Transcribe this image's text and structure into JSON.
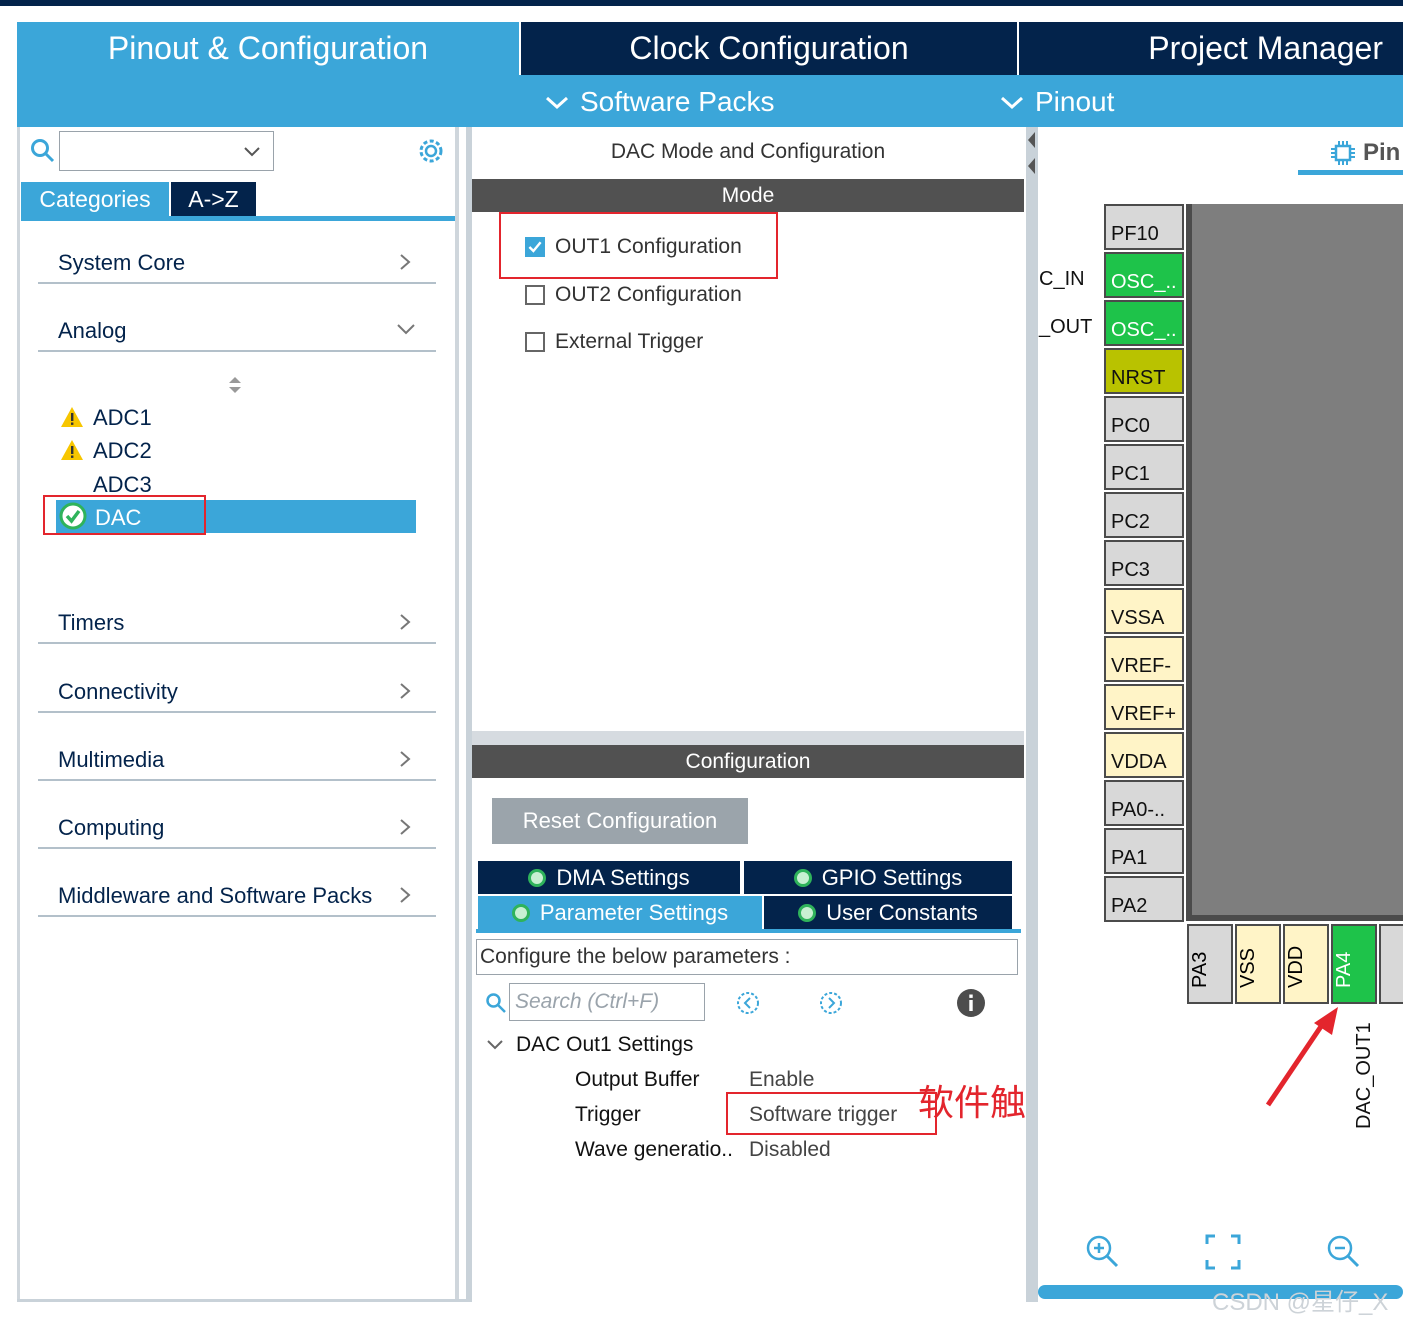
{
  "tabs": [
    {
      "label": "Pinout & Configuration"
    },
    {
      "label": "Clock Configuration"
    },
    {
      "label": "Project Manager"
    }
  ],
  "subbar": {
    "software_packs": "Software Packs",
    "pinout": "Pinout"
  },
  "left": {
    "search": {
      "value": ""
    },
    "tab_categories": "Categories",
    "tab_az": "A->Z",
    "categories": [
      {
        "label": "System Core"
      },
      {
        "label": "Analog"
      },
      {
        "label": "Timers"
      },
      {
        "label": "Connectivity"
      },
      {
        "label": "Multimedia"
      },
      {
        "label": "Computing"
      },
      {
        "label": "Middleware and Software Packs"
      }
    ],
    "analog_items": [
      {
        "label": "ADC1",
        "status": "warning"
      },
      {
        "label": "ADC2",
        "status": "warning"
      },
      {
        "label": "ADC3",
        "status": "none"
      },
      {
        "label": "DAC",
        "status": "ok"
      }
    ]
  },
  "middle": {
    "title": "DAC Mode and Configuration",
    "mode_header": "Mode",
    "mode_options": [
      {
        "label": "OUT1 Configuration",
        "checked": true
      },
      {
        "label": "OUT2 Configuration",
        "checked": false
      },
      {
        "label": "External Trigger",
        "checked": false
      }
    ],
    "config_header": "Configuration",
    "reset_button": "Reset Configuration",
    "settings_tabs": [
      {
        "label": "DMA Settings"
      },
      {
        "label": "GPIO Settings"
      },
      {
        "label": "Parameter Settings"
      },
      {
        "label": "User Constants"
      }
    ],
    "configure_text": "Configure the below parameters :",
    "param_search_placeholder": "Search (Ctrl+F)",
    "group_label": "DAC Out1 Settings",
    "params": [
      {
        "name": "Output Buffer",
        "value": "Enable"
      },
      {
        "name": "Trigger",
        "value": "Software trigger"
      },
      {
        "name": "Wave generatio..",
        "value": "Disabled"
      }
    ],
    "annotation": "软件触发"
  },
  "right": {
    "view_tab": "Pin",
    "side_labels": [
      "C_IN",
      "_OUT"
    ],
    "left_pins": [
      {
        "label": "PF10",
        "color": "grey"
      },
      {
        "label": "OSC_..",
        "color": "green"
      },
      {
        "label": "OSC_..",
        "color": "green"
      },
      {
        "label": "NRST",
        "color": "olive"
      },
      {
        "label": "PC0",
        "color": "grey"
      },
      {
        "label": "PC1",
        "color": "grey"
      },
      {
        "label": "PC2",
        "color": "grey"
      },
      {
        "label": "PC3",
        "color": "grey"
      },
      {
        "label": "VSSA",
        "color": "cream"
      },
      {
        "label": "VREF-",
        "color": "cream"
      },
      {
        "label": "VREF+",
        "color": "cream"
      },
      {
        "label": "VDDA",
        "color": "cream"
      },
      {
        "label": "PA0-..",
        "color": "grey"
      },
      {
        "label": "PA1",
        "color": "grey"
      },
      {
        "label": "PA2",
        "color": "grey"
      }
    ],
    "bottom_pins": [
      {
        "label": "PA3",
        "color": "grey"
      },
      {
        "label": "VSS",
        "color": "cream"
      },
      {
        "label": "VDD",
        "color": "cream"
      },
      {
        "label": "PA4",
        "color": "green"
      }
    ],
    "pa4_signal": "DAC_OUT1"
  },
  "watermark": "CSDN @星仔_X",
  "colors": {
    "accent": "#3ba6d9",
    "navy": "#03234b",
    "green": "#1ec34a",
    "annotation_red": "#e3252d"
  }
}
